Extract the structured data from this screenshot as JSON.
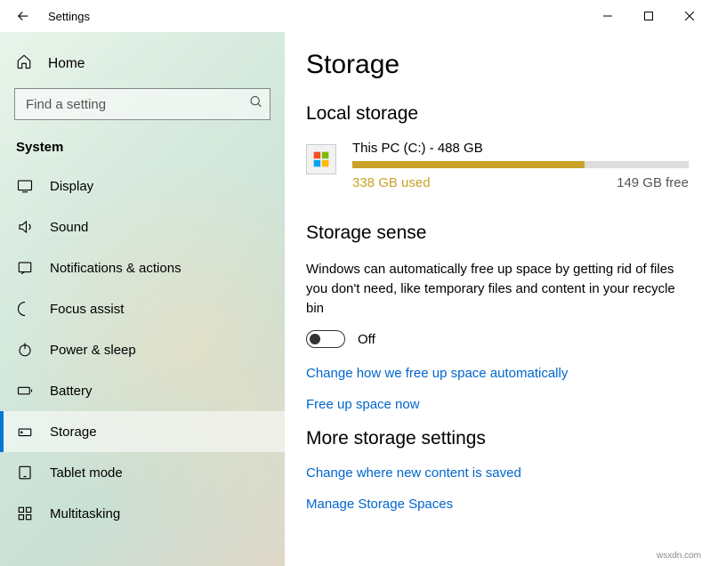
{
  "titlebar": {
    "title": "Settings"
  },
  "sidebar": {
    "home_label": "Home",
    "search_placeholder": "Find a setting",
    "section_label": "System",
    "items": [
      {
        "label": "Display"
      },
      {
        "label": "Sound"
      },
      {
        "label": "Notifications & actions"
      },
      {
        "label": "Focus assist"
      },
      {
        "label": "Power & sleep"
      },
      {
        "label": "Battery"
      },
      {
        "label": "Storage"
      },
      {
        "label": "Tablet mode"
      },
      {
        "label": "Multitasking"
      }
    ]
  },
  "page": {
    "title": "Storage",
    "local_heading": "Local storage",
    "drive": {
      "name": "This PC (C:) - 488 GB",
      "used_label": "338 GB used",
      "free_label": "149 GB free",
      "used_percent": 69
    },
    "sense": {
      "heading": "Storage sense",
      "desc": "Windows can automatically free up space by getting rid of files you don't need, like temporary files and content in your recycle bin",
      "toggle_state": "Off",
      "link_change": "Change how we free up space automatically",
      "link_free": "Free up space now"
    },
    "more": {
      "heading": "More storage settings",
      "link_change_save": "Change where new content is saved",
      "link_spaces": "Manage Storage Spaces"
    }
  },
  "watermark": "wsxdn.com"
}
